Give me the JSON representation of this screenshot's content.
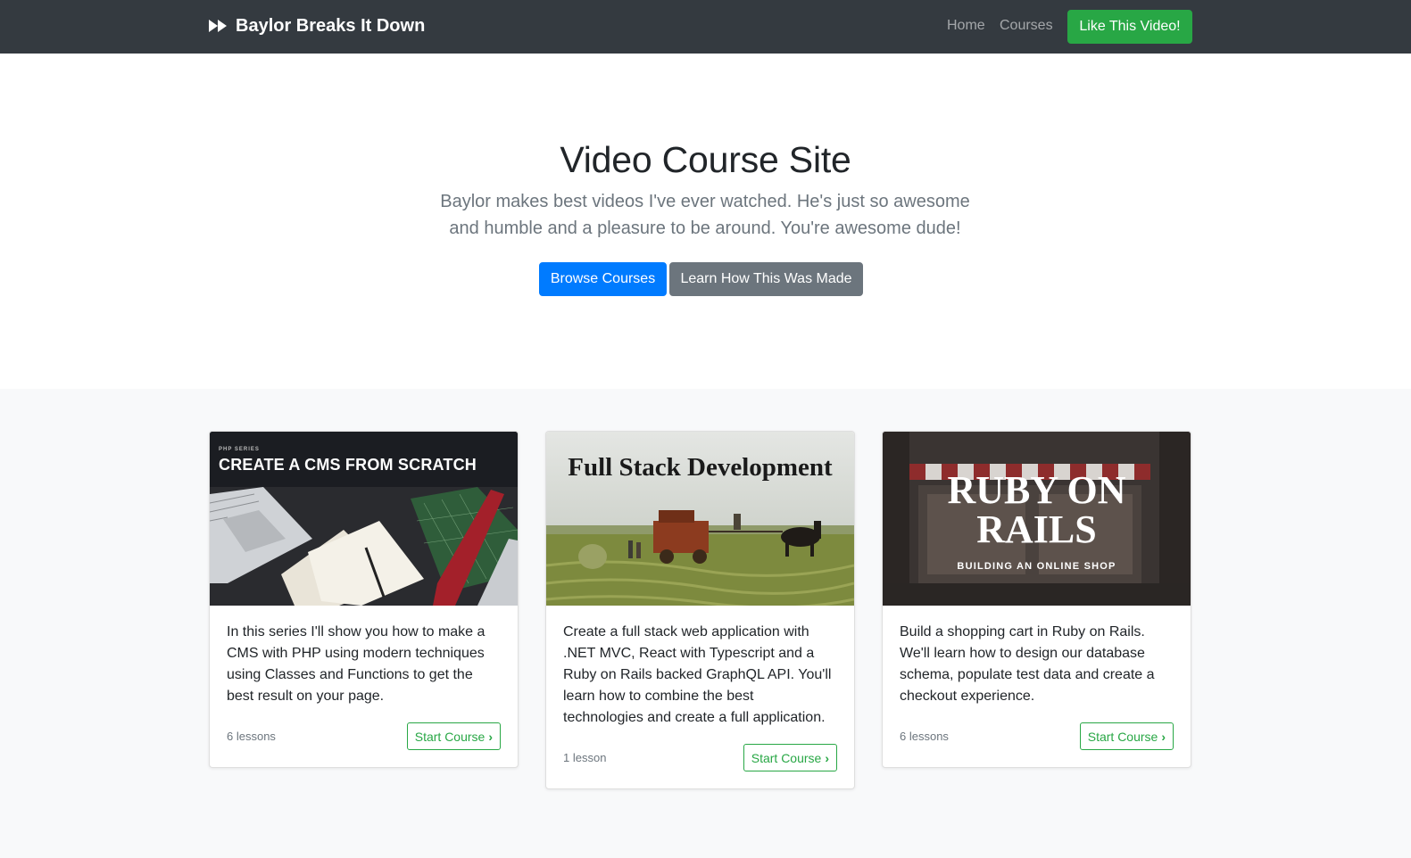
{
  "navbar": {
    "brand": "Baylor Breaks It Down",
    "links": [
      "Home",
      "Courses"
    ],
    "cta": "Like This Video!"
  },
  "hero": {
    "title": "Video Course Site",
    "lead": "Baylor makes best videos I've ever watched. He's just so awesome and humble and a pleasure to be around. You're awesome dude!",
    "primary_button": "Browse Courses",
    "secondary_button": "Learn How This Was Made"
  },
  "courses": [
    {
      "image_overline": "PHP SERIES",
      "image_title": "CREATE A CMS FROM SCRATCH",
      "image_subtitle": "",
      "description": "In this series I'll show you how to make a CMS with PHP using modern techniques using Classes and Functions to get the best result on your page.",
      "lessons": "6 lessons",
      "button": "Start Course"
    },
    {
      "image_overline": "",
      "image_title": "Full Stack Development",
      "image_subtitle": "",
      "description": "Create a full stack web application with .NET MVC, React with Typescript and a Ruby on Rails backed GraphQL API. You'll learn how to combine the best technologies and create a full application.",
      "lessons": "1 lesson",
      "button": "Start Course"
    },
    {
      "image_overline": "",
      "image_title": "RUBY ON RAILS",
      "image_subtitle": "BUILDING AN ONLINE SHOP",
      "description": "Build a shopping cart in Ruby on Rails. We'll learn how to design our database schema, populate test data and create a checkout experience.",
      "lessons": "6 lessons",
      "button": "Start Course"
    }
  ],
  "colors": {
    "navbar_bg": "#343a40",
    "success": "#28a745",
    "primary": "#007bff",
    "secondary": "#6c757d",
    "section_bg": "#f8f9fa"
  },
  "icons": {
    "brand": "fast-forward-icon",
    "start": "chevron-right-icon"
  }
}
